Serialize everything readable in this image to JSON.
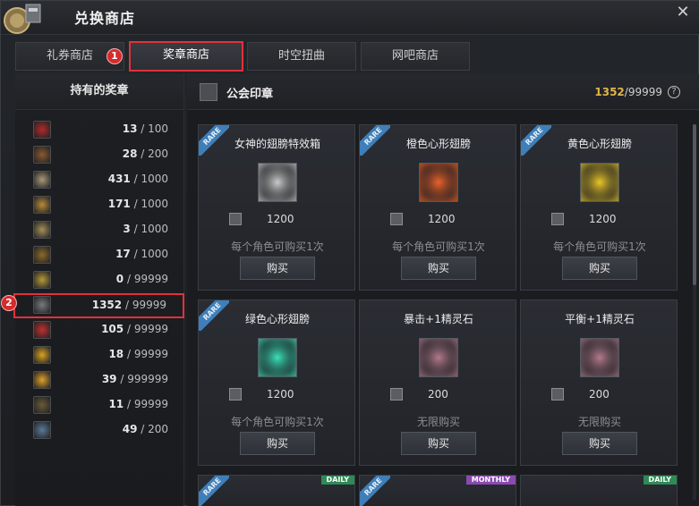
{
  "window": {
    "title": "兑换商店"
  },
  "tabs": [
    {
      "label": "礼券商店",
      "active": false
    },
    {
      "label": "奖章商店",
      "active": true
    },
    {
      "label": "时空扭曲",
      "active": false
    },
    {
      "label": "网吧商店",
      "active": false
    }
  ],
  "annotations": {
    "badge1": "1",
    "badge2": "2"
  },
  "left": {
    "header": "持有的奖章",
    "medals": [
      {
        "icon": "red-medal-icon",
        "color": "#b02a2a",
        "current": "13",
        "max": "100"
      },
      {
        "icon": "bronze-wing-medal-icon",
        "color": "#8a5a32",
        "current": "28",
        "max": "200"
      },
      {
        "icon": "silver-wing-medal-icon",
        "color": "#a89a7a",
        "current": "431",
        "max": "1000"
      },
      {
        "icon": "gold-wing-medal-icon",
        "color": "#b88a3a",
        "current": "171",
        "max": "1000"
      },
      {
        "icon": "cross-medal-icon",
        "color": "#a4905a",
        "current": "3",
        "max": "1000"
      },
      {
        "icon": "eagle-medal-icon",
        "color": "#8b6b2a",
        "current": "17",
        "max": "1000"
      },
      {
        "icon": "gold-emblem-medal-icon",
        "color": "#b59a3a",
        "current": "0",
        "max": "99999"
      },
      {
        "icon": "guild-seal-icon",
        "color": "#777a80",
        "current": "1352",
        "max": "99999"
      },
      {
        "icon": "red-orb-medal-icon",
        "color": "#c03030",
        "current": "105",
        "max": "99999"
      },
      {
        "icon": "smiley-medal-icon",
        "color": "#d9a324",
        "current": "18",
        "max": "99999"
      },
      {
        "icon": "star-face-medal-icon",
        "color": "#e0a02a",
        "current": "39",
        "max": "999999"
      },
      {
        "icon": "dark-medal-icon",
        "color": "#6a5a3a",
        "current": "11",
        "max": "99999"
      },
      {
        "icon": "crossed-swords-medal-icon",
        "color": "#5a7a9a",
        "current": "49",
        "max": "200"
      }
    ]
  },
  "right": {
    "header": {
      "label": "公会印章",
      "current": "1352",
      "max": "/99999"
    },
    "cards": [
      {
        "name": "女神的翅膀特效箱",
        "rare": "RARE",
        "price": "1200",
        "limit": "每个角色可购买1次",
        "buy": "购买",
        "item_color": "#c9c9c9"
      },
      {
        "name": "橙色心形翅膀",
        "rare": "RARE",
        "price": "1200",
        "limit": "每个角色可购买1次",
        "buy": "购买",
        "item_color": "#e8612a"
      },
      {
        "name": "黄色心形翅膀",
        "rare": "RARE",
        "price": "1200",
        "limit": "每个角色可购买1次",
        "buy": "购买",
        "item_color": "#e8c52a"
      },
      {
        "name": "绿色心形翅膀",
        "rare": "RARE",
        "price": "1200",
        "limit": "每个角色可购买1次",
        "buy": "购买",
        "item_color": "#3ae0b8"
      },
      {
        "name": "暴击+1精灵石",
        "rare": "",
        "price": "200",
        "limit": "无限购买",
        "buy": "购买",
        "item_color": "#b07a8a"
      },
      {
        "name": "平衡+1精灵石",
        "rare": "",
        "price": "200",
        "limit": "无限购买",
        "buy": "购买",
        "item_color": "#b07a8a"
      }
    ],
    "partial_cards": [
      {
        "tag": "DAILY",
        "kind": "daily",
        "rare": "RARE"
      },
      {
        "tag": "MONTHLY",
        "kind": "monthly",
        "rare": "RARE"
      },
      {
        "tag": "DAILY",
        "kind": "daily",
        "rare": ""
      }
    ]
  }
}
